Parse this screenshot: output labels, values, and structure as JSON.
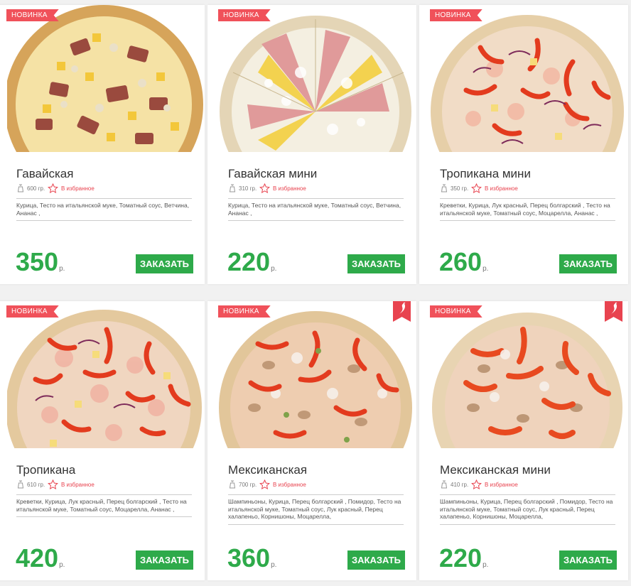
{
  "labels": {
    "new_badge": "НОВИНКА",
    "favorite": "В избранное",
    "order_button": "ЗАКАЗАТЬ",
    "currency": "р."
  },
  "colors": {
    "accent_green": "#2eaa4a",
    "badge_red": "#f0515a",
    "favorite_red": "#e8434f"
  },
  "products": [
    {
      "name": "Гавайская",
      "weight": "600 гр.",
      "ingredients": "Курица, Тесто на итальянской муке, Томатный соус, Ветчина, Ананас ,",
      "price": "350",
      "is_new": true,
      "is_spicy": false
    },
    {
      "name": "Гавайская мини",
      "weight": "310 гр.",
      "ingredients": "Курица, Тесто на итальянской муке, Томатный соус, Ветчина, Ананас ,",
      "price": "220",
      "is_new": true,
      "is_spicy": false
    },
    {
      "name": "Тропикана мини",
      "weight": "350 гр.",
      "ingredients": "Креветки, Курица, Лук красный, Перец болгарский , Тесто на итальянской муке, Томатный соус, Моцарелла, Ананас ,",
      "price": "260",
      "is_new": true,
      "is_spicy": false
    },
    {
      "name": "Тропикана",
      "weight": "610 гр.",
      "ingredients": "Креветки, Курица, Лук красный, Перец болгарский , Тесто на итальянской муке, Томатный соус, Моцарелла, Ананас ,",
      "price": "420",
      "is_new": true,
      "is_spicy": false
    },
    {
      "name": "Мексиканская",
      "weight": "700 гр.",
      "ingredients": "Шампиньоны, Курица, Перец болгарский , Помидор, Тесто на итальянской муке, Томатный соус, Лук красный, Перец халапеньо, Корнишоны, Моцарелла,",
      "price": "360",
      "is_new": true,
      "is_spicy": true
    },
    {
      "name": "Мексиканская мини",
      "weight": "410 гр.",
      "ingredients": "Шампиньоны, Курица, Перец болгарский , Помидор, Тесто на итальянской муке, Томатный соус, Лук красный, Перец халапеньо, Корнишоны, Моцарелла,",
      "price": "220",
      "is_new": true,
      "is_spicy": true
    }
  ]
}
